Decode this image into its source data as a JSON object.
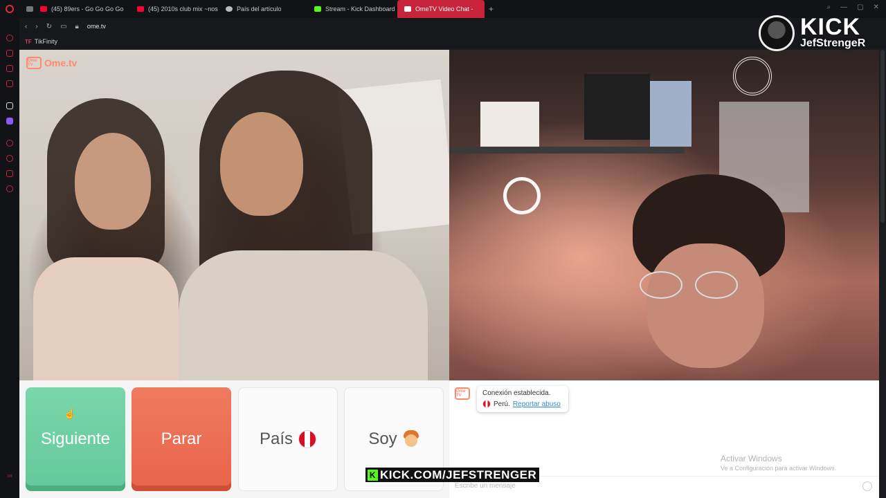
{
  "browser": {
    "tabs": [
      {
        "label": "(45) 89ers - Go Go Go Go",
        "icon": "youtube-icon",
        "color": "#ff0033",
        "active": false
      },
      {
        "label": "(45) 2010s club mix ~nos",
        "icon": "youtube-icon",
        "color": "#ff0033",
        "active": false
      },
      {
        "label": "País del artículo",
        "icon": "globe-icon",
        "color": "#bbbbbb",
        "active": false
      },
      {
        "label": "Stream - Kick Dashboard",
        "icon": "kick-icon",
        "color": "#53fc18",
        "active": false
      },
      {
        "label": "OmeTV Video Chat -",
        "icon": "ometv-icon",
        "color": "#ffffff",
        "active": true
      }
    ],
    "url": "ome.tv",
    "bookmark": "TikFinity",
    "bookmark_prefix": "TF"
  },
  "ome": {
    "logo_box": "Ome TV",
    "logo_text": "Ome.tv"
  },
  "controls": {
    "next_label": "Siguiente",
    "stop_label": "Parar",
    "country_label": "País",
    "me_label": "Soy"
  },
  "chat": {
    "status": "Conexión establecida.",
    "country": "Perú.",
    "report_link": "Reportar abuso",
    "input_placeholder": "Escribe un mensaje"
  },
  "windows_watermark": {
    "line1": "Activar Windows",
    "line2": "Ve a Configuración para activar Windows."
  },
  "overlay": {
    "platform": "KICK",
    "channel": "JefStrengeR",
    "url": "KICK.COM/JEFSTRENGER",
    "k": "K"
  },
  "sidebar_bottom": "ox",
  "colors": {
    "accent": "#c7243b",
    "next_green": "#6fd2a3",
    "stop_red": "#ea6b50",
    "kick_green": "#53fc18"
  }
}
